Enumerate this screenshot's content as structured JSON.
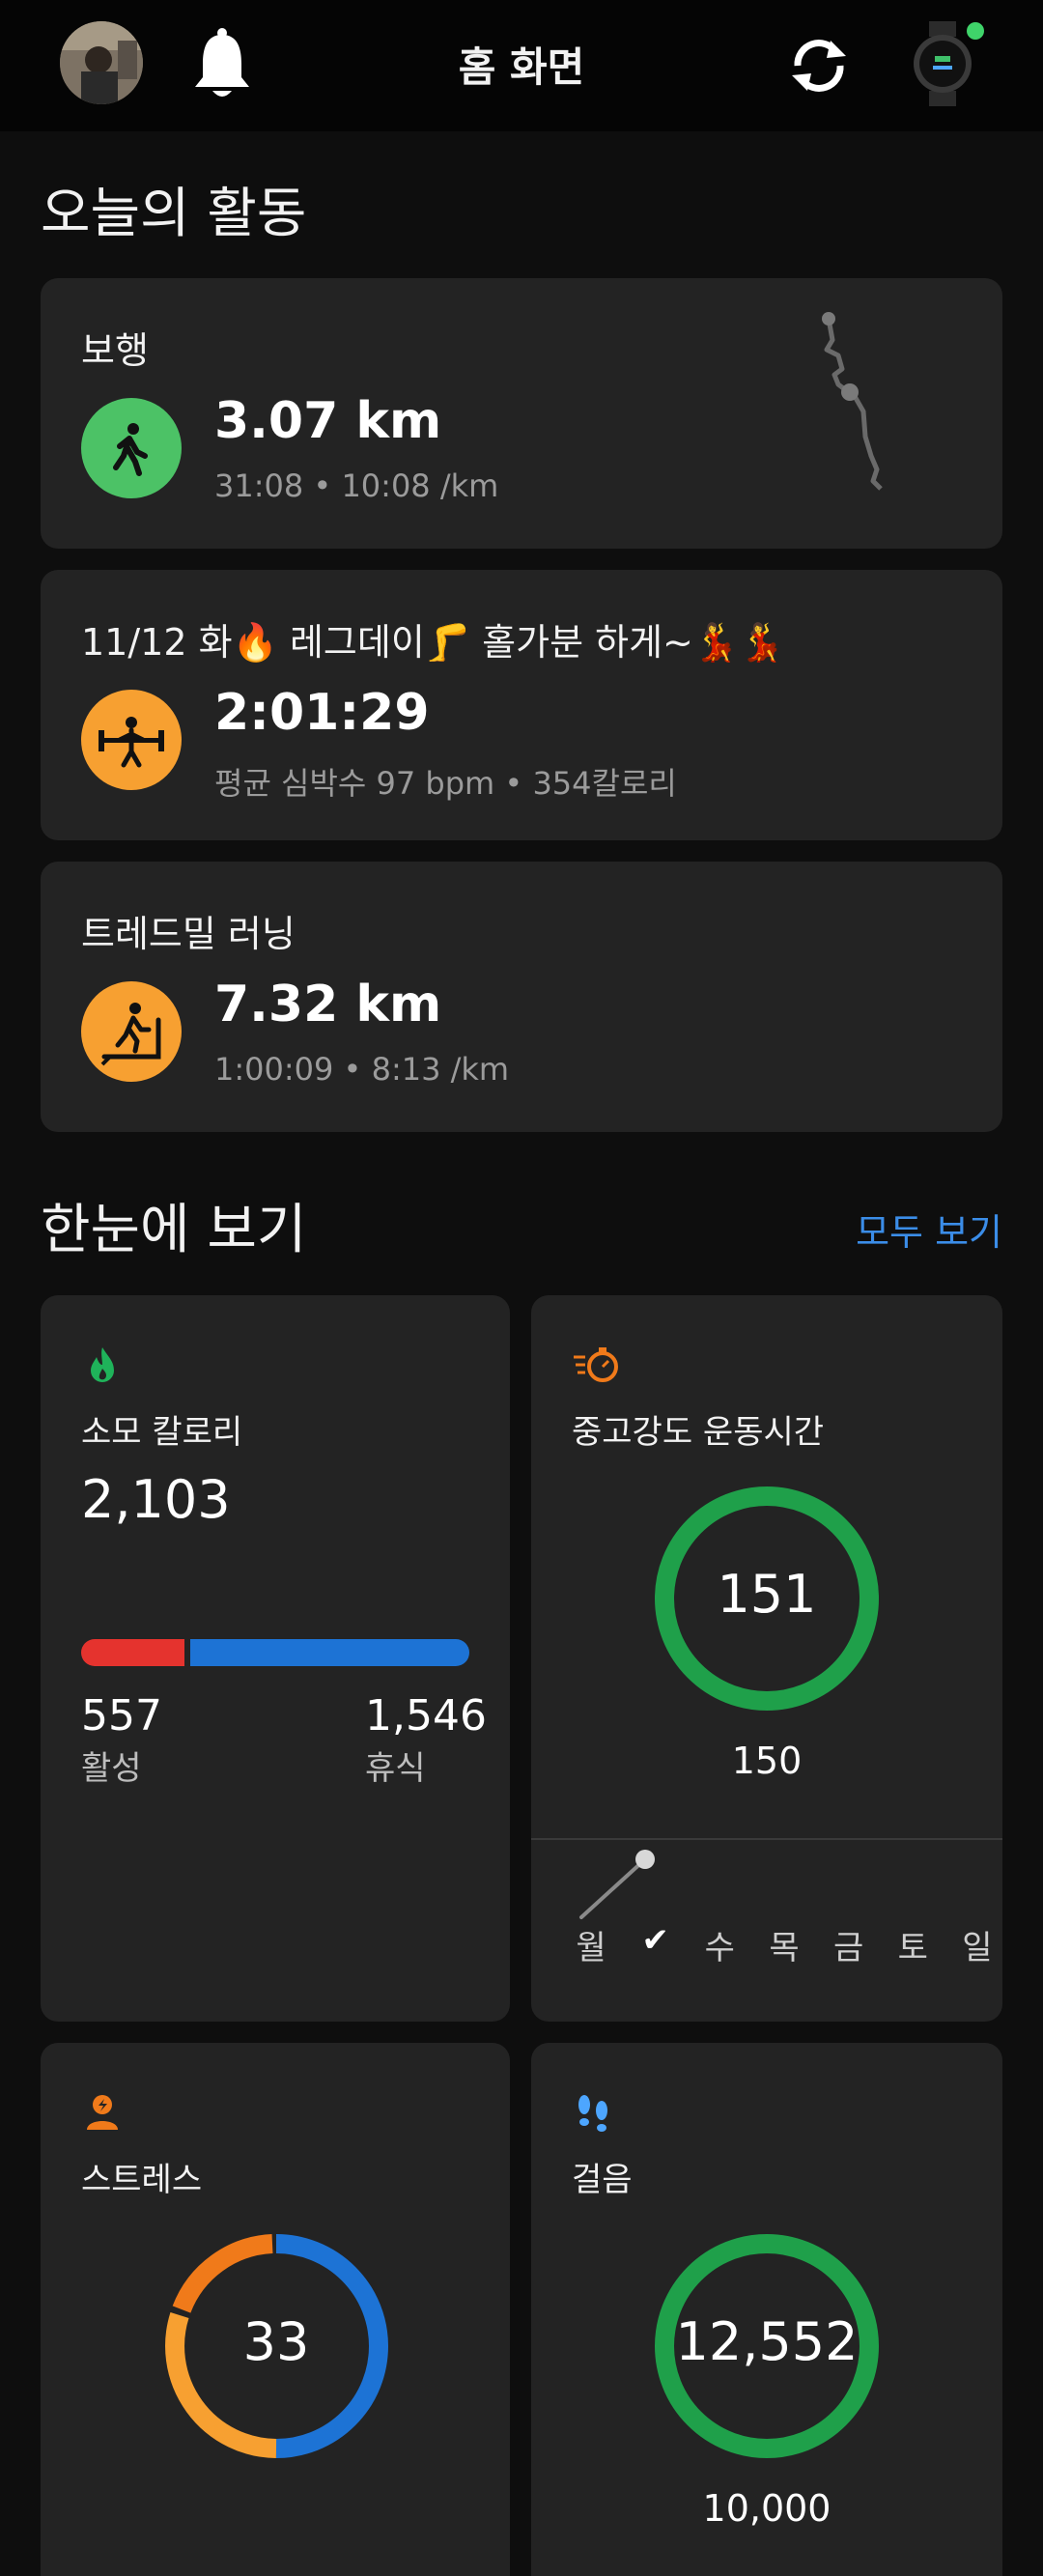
{
  "header": {
    "title": "홈 화면",
    "icons": [
      "avatar",
      "bell-icon",
      "sync-icon",
      "watch-icon"
    ]
  },
  "today": {
    "section_title": "오늘의 활동",
    "activities": [
      {
        "label": "보행",
        "value": "3.07 km",
        "sub": "31:08 • 10:08 /km",
        "icon": "walking-icon",
        "color": "#4cc266"
      },
      {
        "label": "11/12 화🔥 레그데이🦵  홀가분 하게~💃💃",
        "value": "2:01:29",
        "sub": "평균 심박수 97 bpm • 354칼로리",
        "icon": "weightlifting-icon",
        "color": "#f7a031"
      },
      {
        "label": "트레드밀 러닝",
        "value": "7.32 km",
        "sub": "1:00:09 • 8:13 /km",
        "icon": "treadmill-icon",
        "color": "#f7a031"
      }
    ]
  },
  "glance": {
    "section_title": "한눈에 보기",
    "see_all": "모두 보기",
    "calories": {
      "title": "소모 칼로리",
      "total": "2,103",
      "active_value": "557",
      "active_label": "활성",
      "rest_value": "1,546",
      "rest_label": "휴식",
      "active_fraction": 0.265,
      "colors": {
        "active": "#e5332e",
        "rest": "#1d73d5"
      }
    },
    "intensity": {
      "title": "중고강도 운동시간",
      "value": "151",
      "goal": "150",
      "days": [
        "월",
        "✔",
        "수",
        "목",
        "금",
        "토",
        "일"
      ],
      "ring_color": "#1fa04a"
    },
    "stress": {
      "title": "스트레스",
      "value": "33",
      "colors": {
        "rest": "#1d73d5",
        "low": "#f7a031",
        "mid": "#f07a1a"
      }
    },
    "steps": {
      "title": "걸음",
      "value": "12,552",
      "goal": "10,000",
      "ring_color": "#1fa04a"
    }
  }
}
